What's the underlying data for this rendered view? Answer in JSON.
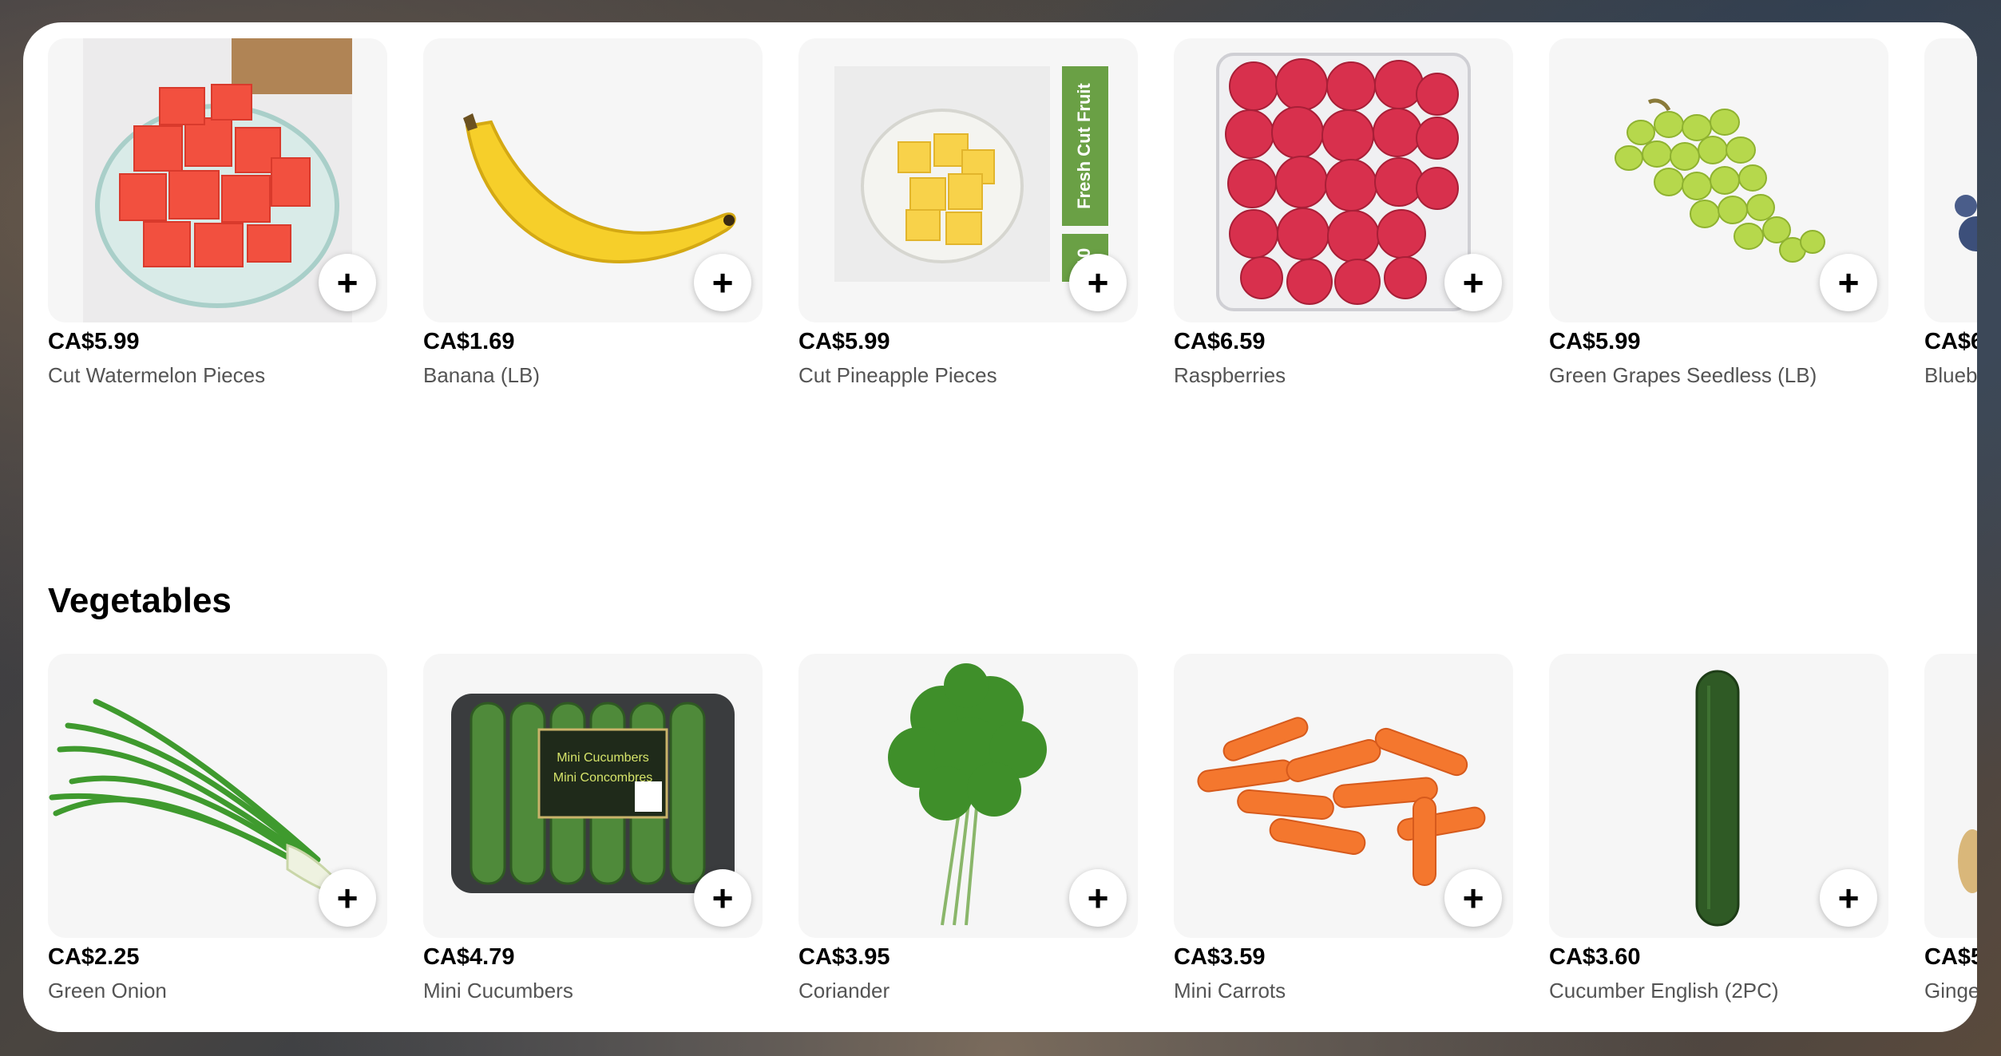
{
  "fruits": {
    "items": [
      {
        "price": "CA$5.99",
        "name": "Cut Watermelon Pieces",
        "image_icon": "watermelon-icon"
      },
      {
        "price": "CA$1.69",
        "name": "Banana (LB)",
        "image_icon": "banana-icon"
      },
      {
        "price": "CA$5.99",
        "name": "Cut Pineapple Pieces",
        "image_icon": "pineapple-icon",
        "package_label": "Fresh Cut Fruit",
        "package_number": "10"
      },
      {
        "price": "CA$6.59",
        "name": "Raspberries",
        "image_icon": "raspberry-icon"
      },
      {
        "price": "CA$5.99",
        "name": "Green Grapes Seedless (LB)",
        "image_icon": "grapes-icon"
      },
      {
        "price": "CA$6",
        "name": "Blueb",
        "image_icon": "blueberry-icon"
      }
    ]
  },
  "vegetables": {
    "title": "Vegetables",
    "items": [
      {
        "price": "CA$2.25",
        "name": "Green Onion",
        "image_icon": "green-onion-icon"
      },
      {
        "price": "CA$4.79",
        "name": "Mini Cucumbers",
        "image_icon": "mini-cucumbers-icon",
        "package_label_1": "Mini Cucumbers",
        "package_label_2": "Mini Concombres"
      },
      {
        "price": "CA$3.95",
        "name": "Coriander",
        "image_icon": "coriander-icon"
      },
      {
        "price": "CA$3.59",
        "name": "Mini Carrots",
        "image_icon": "carrot-icon"
      },
      {
        "price": "CA$3.60",
        "name": "Cucumber English (2PC)",
        "image_icon": "cucumber-icon"
      },
      {
        "price": "CA$5",
        "name": "Ginge",
        "image_icon": "ginger-icon"
      }
    ]
  },
  "add_button_label": "+",
  "colors": {
    "panel": "#ffffff",
    "thumb_bg": "#f6f6f6",
    "name_text": "#545454"
  }
}
